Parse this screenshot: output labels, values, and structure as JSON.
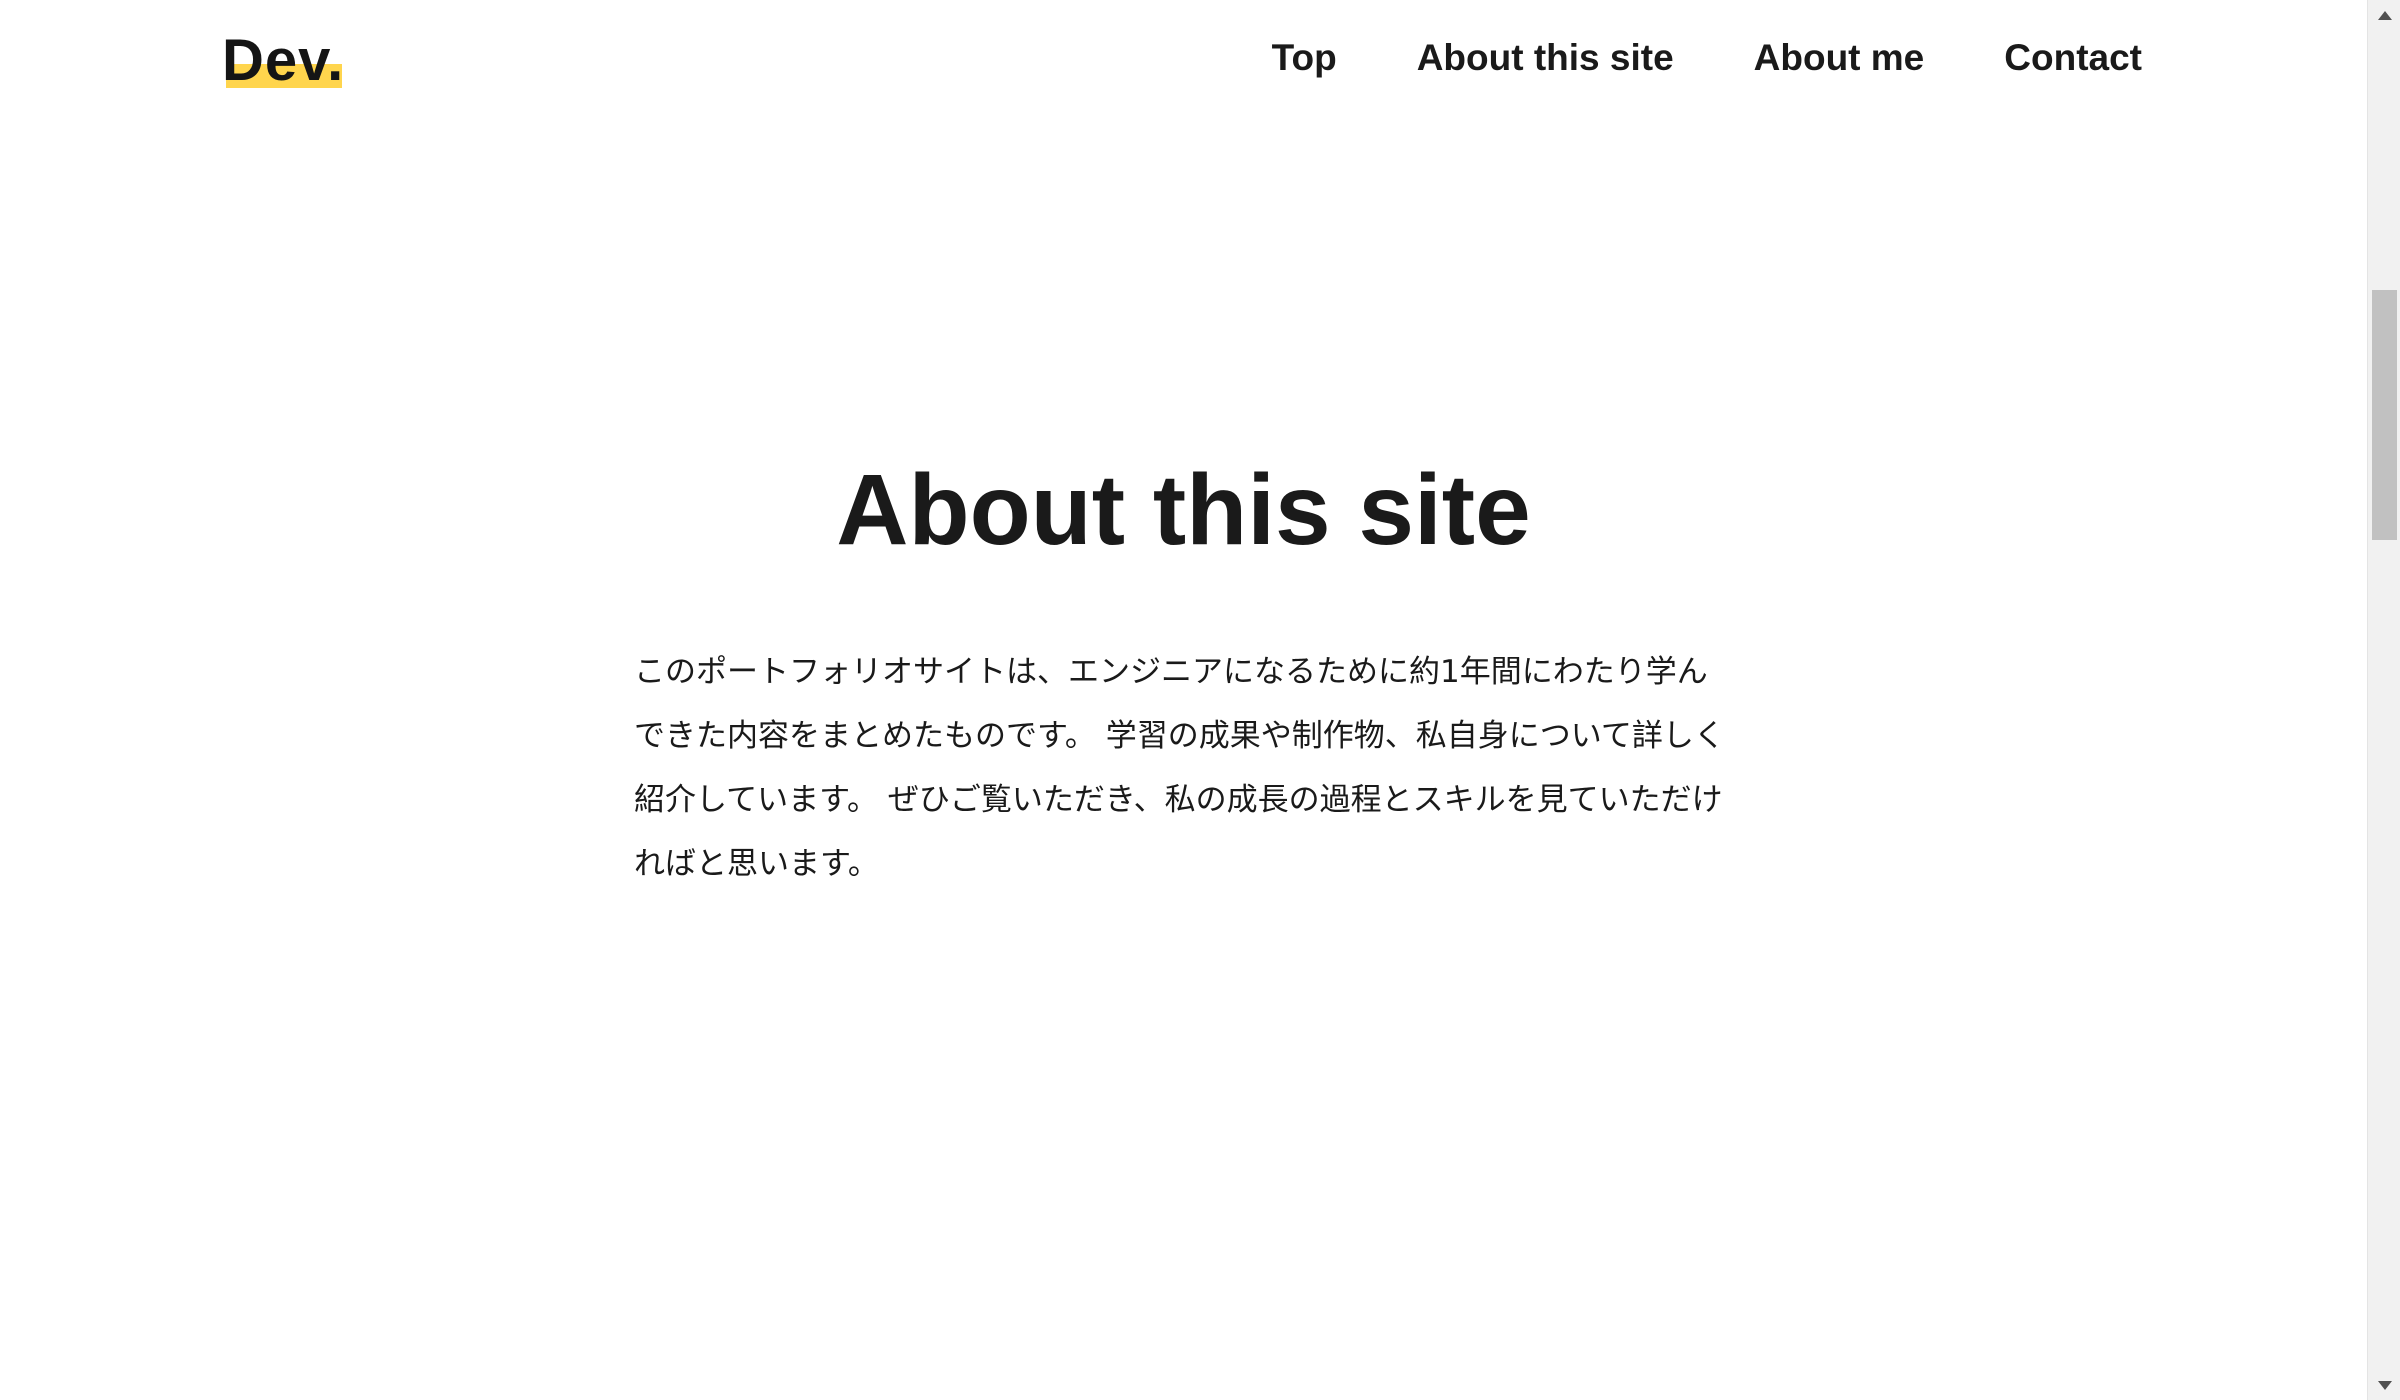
{
  "header": {
    "logo": "Dev.",
    "nav": [
      {
        "label": "Top"
      },
      {
        "label": "About this site"
      },
      {
        "label": "About me"
      },
      {
        "label": "Contact"
      }
    ]
  },
  "main": {
    "title": "About this site",
    "body": "このポートフォリオサイトは、エンジニアになるために約1年間にわたり学んできた内容をまとめたものです。 学習の成果や制作物、私自身について詳しく紹介しています。 ぜひご覧いただき、私の成長の過程とスキルを見ていただければと思います。"
  },
  "colors": {
    "accent": "#ffd54d",
    "text": "#1a1a1a",
    "background": "#ffffff"
  },
  "icons": [
    "scroll-up-arrow-icon",
    "scroll-down-arrow-icon"
  ]
}
